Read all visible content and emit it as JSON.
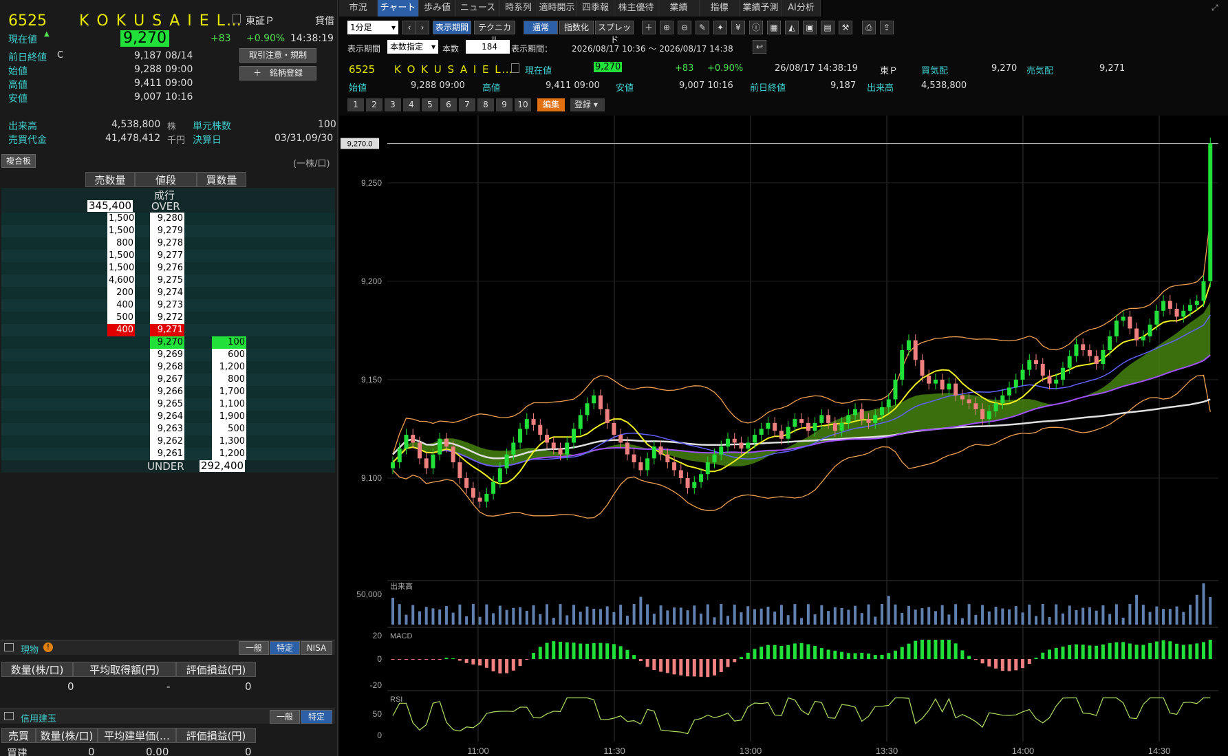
{
  "left": {
    "code": "6525",
    "name": "K O K U S A I E L…",
    "market": "東証Ｐ",
    "loan": "貸借",
    "price_label": "現在値",
    "price": "9,270",
    "change": "+83",
    "change_pct": "+0.90%",
    "time": "14:38:19",
    "prev_close_label": "前日終値",
    "prev_close_flag": "C",
    "prev_close": "9,187",
    "prev_close_date": "08/14",
    "open_label": "始値",
    "open": "9,288",
    "open_time": "09:00",
    "high_label": "高値",
    "high": "9,411",
    "high_time": "09:00",
    "low_label": "安値",
    "low": "9,007",
    "low_time": "10:16",
    "btn_caution": "取引注意・規制",
    "btn_register": "＋　銘柄登録",
    "volume_label": "出来高",
    "volume": "4,538,800",
    "volume_unit": "株",
    "lot_label": "単元株数",
    "lot": "100",
    "turnover_label": "売買代金",
    "turnover": "41,478,412",
    "turnover_unit": "千円",
    "settle_label": "決算日",
    "settle": "03/31,09/30",
    "board_button": "複合板",
    "board_unit": "(一株/口)",
    "board_headers": [
      "売数量",
      "値段",
      "買数量"
    ],
    "market_order": "成行",
    "over_qty": "345,400",
    "over_label": "OVER",
    "under_label": "UNDER",
    "under_qty": "292,400",
    "asks": [
      {
        "qty": "1,500",
        "price": "9,280"
      },
      {
        "qty": "1,500",
        "price": "9,279"
      },
      {
        "qty": "800",
        "price": "9,278"
      },
      {
        "qty": "1,500",
        "price": "9,277"
      },
      {
        "qty": "1,500",
        "price": "9,276"
      },
      {
        "qty": "4,600",
        "price": "9,275"
      },
      {
        "qty": "200",
        "price": "9,274"
      },
      {
        "qty": "400",
        "price": "9,273"
      },
      {
        "qty": "500",
        "price": "9,272"
      },
      {
        "qty": "400",
        "price": "9,271"
      }
    ],
    "bids": [
      {
        "price": "9,270",
        "qty": "100"
      },
      {
        "price": "9,269",
        "qty": "600"
      },
      {
        "price": "9,268",
        "qty": "1,200"
      },
      {
        "price": "9,267",
        "qty": "800"
      },
      {
        "price": "9,266",
        "qty": "1,700"
      },
      {
        "price": "9,265",
        "qty": "1,100"
      },
      {
        "price": "9,264",
        "qty": "1,900"
      },
      {
        "price": "9,263",
        "qty": "500"
      },
      {
        "price": "9,262",
        "qty": "1,300"
      },
      {
        "price": "9,261",
        "qty": "1,200"
      }
    ],
    "spot_title": "現物",
    "spot_tabs": [
      "一般",
      "特定",
      "NISA"
    ],
    "spot_headers": [
      "数量(株/口)",
      "平均取得額(円)",
      "評価損益(円)"
    ],
    "spot_values": [
      "0",
      "-",
      "0"
    ],
    "margin_title": "信用建玉",
    "margin_tabs": [
      "一般",
      "特定"
    ],
    "margin_headers": [
      "売買",
      "数量(株/口)",
      "平均建単価(…",
      "評価損益(円)"
    ],
    "margin_values": [
      "買建",
      "0",
      "0.00",
      "0"
    ]
  },
  "tabs": [
    "市況",
    "チャート",
    "歩み値",
    "ニュース",
    "時系列",
    "適時開示",
    "四季報",
    "株主優待",
    "業績",
    "指標",
    "業績予測",
    "AI分析"
  ],
  "toolbar": {
    "interval": "1分足",
    "btn_period": "表示期間",
    "btn_tech": "テクニカル",
    "btn_normal": "通常",
    "btn_index": "指数化",
    "btn_spread": "スプレッド",
    "period_label": "表示期間",
    "period_mode": "本数指定",
    "count_label": "本数",
    "count": "184",
    "range_label": "表示期間：",
    "range": "2026/08/17 10:36 ～ 2026/08/17 14:38"
  },
  "quote": {
    "code": "6525",
    "name": "K O K U S A I E L…",
    "price_label": "現在値",
    "price": "9,270",
    "change": "+83",
    "change_pct": "+0.90%",
    "datetime": "26/08/17 14:38:19",
    "market": "東Ｐ",
    "bid_label": "買気配",
    "bid": "9,270",
    "ask_label": "売気配",
    "ask": "9,271",
    "open_label": "始値",
    "open": "9,288 09:00",
    "high_label": "高値",
    "high": "9,411 09:00",
    "low_label": "安値",
    "low": "9,007 10:16",
    "prev_label": "前日終値",
    "prev": "9,187",
    "vol_label": "出来高",
    "vol": "4,538,800"
  },
  "presets": [
    "1",
    "2",
    "3",
    "4",
    "5",
    "6",
    "7",
    "8",
    "9",
    "10"
  ],
  "edit_btn": "編集",
  "register_btn": "登録",
  "colors": {
    "up": "#22e03a",
    "down": "#f08080",
    "accent": "#2b5fa8",
    "bb": "#f0a050",
    "ma_short": "#f0f020",
    "ma_mid": "#6060ff",
    "ma_long": "#e0e0e0",
    "cloud_up": "#4a8a10",
    "cloud_down": "#7a3030"
  },
  "chart_data": {
    "type": "candlestick",
    "title": "",
    "price_label": "9,270.0",
    "y_ticks": [
      "9,250",
      "9,200",
      "9,150",
      "9,100"
    ],
    "ylim": [
      9050,
      9280
    ],
    "x_ticks": [
      "11:00",
      "11:30",
      "13:00",
      "13:30",
      "14:00",
      "14:30"
    ],
    "closes": [
      9108,
      9115,
      9122,
      9118,
      9110,
      9105,
      9112,
      9120,
      9116,
      9108,
      9100,
      9095,
      9090,
      9088,
      9092,
      9098,
      9105,
      9112,
      9118,
      9125,
      9130,
      9127,
      9122,
      9118,
      9115,
      9112,
      9118,
      9125,
      9132,
      9138,
      9142,
      9135,
      9128,
      9122,
      9118,
      9112,
      9108,
      9104,
      9110,
      9116,
      9112,
      9108,
      9104,
      9100,
      9095,
      9098,
      9102,
      9108,
      9112,
      9116,
      9120,
      9118,
      9115,
      9118,
      9122,
      9125,
      9128,
      9124,
      9120,
      9126,
      9130,
      9128,
      9124,
      9128,
      9132,
      9128,
      9124,
      9128,
      9132,
      9135,
      9130,
      9128,
      9132,
      9136,
      9140,
      9150,
      9165,
      9170,
      9160,
      9152,
      9148,
      9150,
      9145,
      9148,
      9142,
      9140,
      9138,
      9135,
      9130,
      9134,
      9138,
      9142,
      9146,
      9150,
      9155,
      9160,
      9158,
      9152,
      9148,
      9150,
      9156,
      9162,
      9168,
      9165,
      9162,
      9158,
      9165,
      9172,
      9180,
      9182,
      9176,
      9170,
      9172,
      9178,
      9185,
      9190,
      9186,
      9182,
      9185,
      9188,
      9190,
      9200,
      9270
    ],
    "volume_label": "出来高",
    "volume_ticks": [
      "50,000"
    ],
    "macd_label": "MACD",
    "macd_ticks": [
      "20",
      "0",
      "-20"
    ],
    "rsi_label": "RSI",
    "rsi_ticks": [
      "50",
      "0"
    ]
  }
}
